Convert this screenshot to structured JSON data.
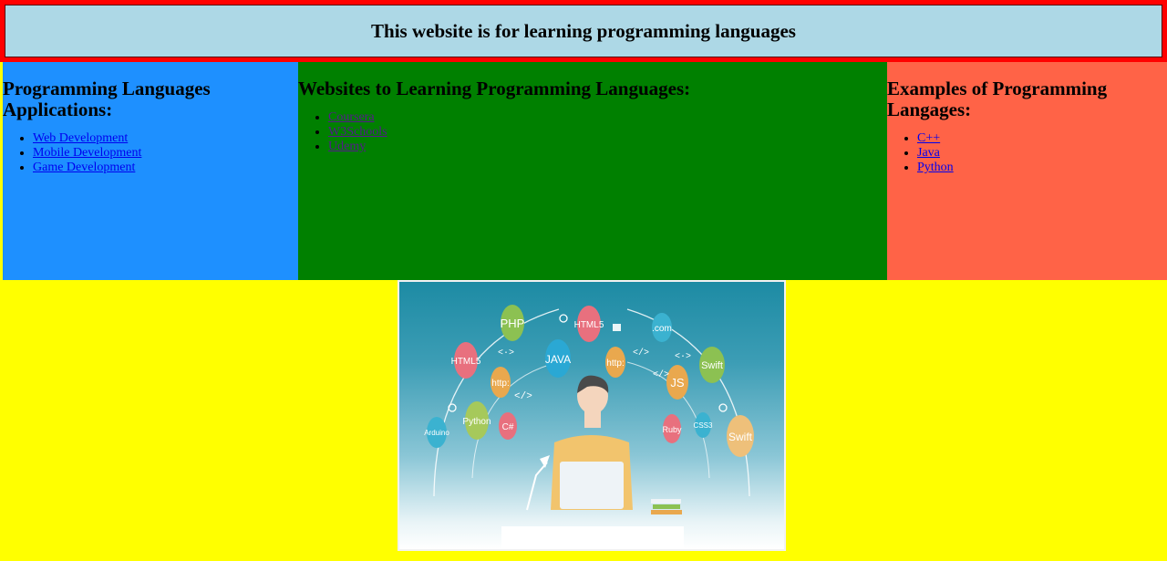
{
  "header": {
    "title": "This website is for learning programming languages"
  },
  "applications": {
    "heading": "Programming Languages Applications:",
    "links": [
      "Web Development",
      "Mobile Development",
      "Game Development"
    ]
  },
  "websites": {
    "heading": "Websites to Learning Programming Languages:",
    "links": [
      "Coursera",
      "W3Schools",
      "Udemy"
    ]
  },
  "examples": {
    "heading": "Examples of Programming Langages:",
    "links": [
      "C++",
      "Java",
      "Python"
    ]
  },
  "illustration": {
    "bubbles": [
      "PHP",
      "HTML5",
      ".com",
      "HTML5",
      "JAVA",
      "http:",
      "JS",
      "Swift",
      "http:",
      "Python",
      "C#",
      "Arduino",
      "Ruby",
      "CSS3",
      "Swift"
    ],
    "symbols": [
      "<·>",
      "</>",
      "</>",
      "<·>",
      "</>"
    ]
  },
  "colors": {
    "page_bg": "#ffff00",
    "header_bg": "#add8e6",
    "header_border": "#ff0000",
    "col1_bg": "#1e90ff",
    "col2_bg": "#008000",
    "col3_bg": "#ff6347"
  }
}
